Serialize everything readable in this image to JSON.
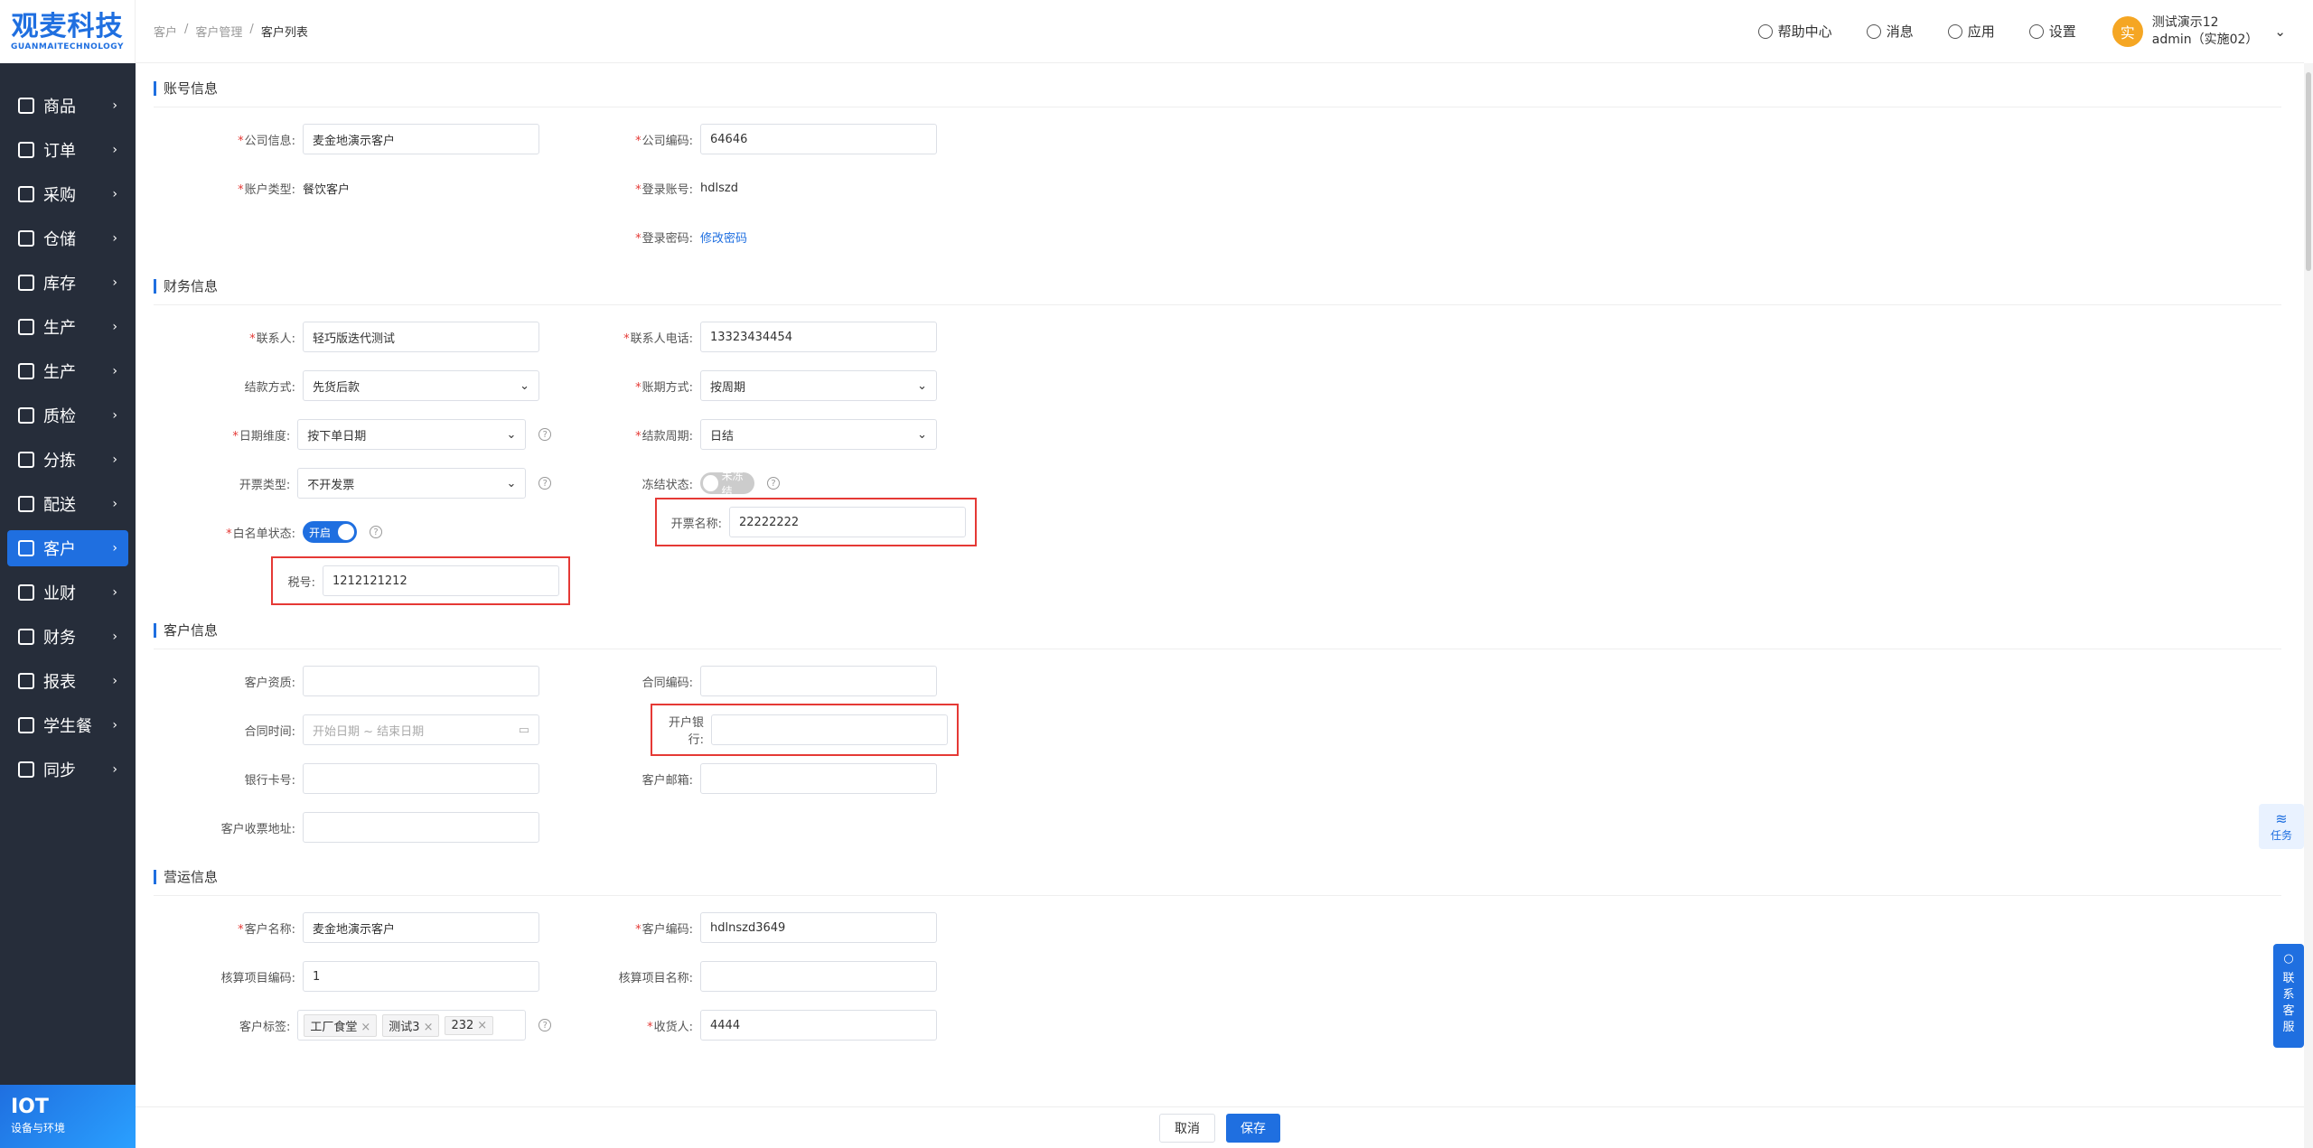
{
  "logo": {
    "main": "观麦科技",
    "sub": "GUANMAITECHNOLOGY"
  },
  "sidebar": {
    "items": [
      {
        "label": "商品",
        "icon": "grid-icon"
      },
      {
        "label": "订单",
        "icon": "clipboard-icon"
      },
      {
        "label": "采购",
        "icon": "basket-icon"
      },
      {
        "label": "仓储",
        "icon": "warehouse-icon"
      },
      {
        "label": "库存",
        "icon": "stock-icon"
      },
      {
        "label": "生产",
        "icon": "factory-icon"
      },
      {
        "label": "生产",
        "icon": "factory-icon"
      },
      {
        "label": "质检",
        "icon": "shield-icon"
      },
      {
        "label": "分拣",
        "icon": "sort-icon"
      },
      {
        "label": "配送",
        "icon": "truck-icon"
      },
      {
        "label": "客户",
        "icon": "users-icon",
        "active": true
      },
      {
        "label": "业财",
        "icon": "chart-icon"
      },
      {
        "label": "财务",
        "icon": "finance-icon"
      },
      {
        "label": "报表",
        "icon": "report-icon"
      },
      {
        "label": "学生餐",
        "icon": "meal-icon"
      },
      {
        "label": "同步",
        "icon": "sync-icon"
      }
    ],
    "iot_title": "IOT",
    "iot_sub": "设备与环境"
  },
  "header": {
    "breadcrumb": [
      "客户",
      "/",
      "客户管理",
      "/",
      "客户列表"
    ],
    "help": "帮助中心",
    "messages": "消息",
    "apps": "应用",
    "settings": "设置",
    "avatar_char": "实",
    "user_name": "测试演示12",
    "user_role": "admin（实施02）"
  },
  "account": {
    "title": "账号信息",
    "company_info_label": "公司信息:",
    "company_info": "麦金地演示客户",
    "company_code_label": "公司编码:",
    "company_code": "64646",
    "account_type_label": "账户类型:",
    "account_type": "餐饮客户",
    "login_account_label": "登录账号:",
    "login_account": "hdlszd",
    "login_password_label": "登录密码:",
    "change_password": "修改密码"
  },
  "finance": {
    "title": "财务信息",
    "contact_label": "联系人:",
    "contact": "轻巧版迭代测试",
    "phone_label": "联系人电话:",
    "phone": "13323434454",
    "pay_method_label": "结款方式:",
    "pay_method": "先货后款",
    "period_method_label": "账期方式:",
    "period_method": "按周期",
    "date_dim_label": "日期维度:",
    "date_dim": "按下单日期",
    "settle_cycle_label": "结款周期:",
    "settle_cycle": "日结",
    "invoice_type_label": "开票类型:",
    "invoice_type": "不开发票",
    "freeze_label": "冻结状态:",
    "freeze_text": "未冻结",
    "whitelist_label": "白名单状态:",
    "whitelist_text": "开启",
    "invoice_name_label": "开票名称:",
    "invoice_name": "22222222",
    "tax_no_label": "税号:",
    "tax_no": "1212121212"
  },
  "customer": {
    "title": "客户信息",
    "qualify_label": "客户资质:",
    "contract_code_label": "合同编码:",
    "contract_time_label": "合同时间:",
    "contract_time_placeholder": "开始日期 ~ 结束日期",
    "bank_label": "开户银行:",
    "card_label": "银行卡号:",
    "email_label": "客户邮箱:",
    "invoice_addr_label": "客户收票地址:"
  },
  "operation": {
    "title": "营运信息",
    "name_label": "客户名称:",
    "name": "麦金地演示客户",
    "code_label": "客户编码:",
    "code": "hdlnszd3649",
    "proj_code_label": "核算项目编码:",
    "proj_code": "1",
    "proj_name_label": "核算项目名称:",
    "tags_label": "客户标签:",
    "tags": [
      "工厂食堂",
      "测试3",
      "232"
    ],
    "receiver_label": "收货人:",
    "receiver": "4444"
  },
  "footer": {
    "cancel": "取消",
    "save": "保存"
  },
  "float": {
    "task": "任务",
    "service": [
      "联",
      "系",
      "客",
      "服"
    ]
  }
}
